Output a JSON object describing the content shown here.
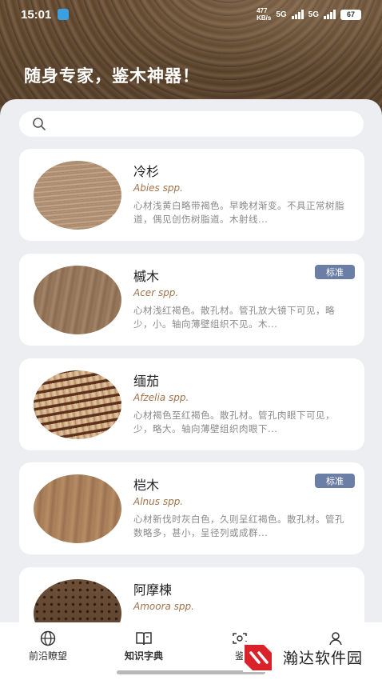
{
  "status": {
    "time": "15:01",
    "net_speed_top": "477",
    "net_speed_bottom": "KB/s",
    "signal1": "5G",
    "signal2": "5G",
    "battery": "67"
  },
  "header": {
    "slogan": "随身专家，鉴木神器！"
  },
  "search": {
    "placeholder": ""
  },
  "woods": [
    {
      "name": "冷杉",
      "latin": "Abies spp.",
      "desc": "心材浅黄白略带褐色。早晚材渐变。不具正常树脂道，偶见创伤树脂道。木射线...",
      "badge": ""
    },
    {
      "name": "槭木",
      "latin": "Acer spp.",
      "desc": "心材浅红褐色。散孔材。管孔放大镜下可见，略少，小。轴向薄壁组织不见。木...",
      "badge": "标准"
    },
    {
      "name": "缅茄",
      "latin": "Afzelia spp.",
      "desc": "心材褐色至红褐色。散孔材。管孔肉眼下可见，少，略大。轴向薄壁组织肉眼下...",
      "badge": ""
    },
    {
      "name": "桤木",
      "latin": "Alnus spp.",
      "desc": "心材新伐时灰白色，久则呈红褐色。散孔材。管孔数略多，甚小，呈径列或成群...",
      "badge": "标准"
    },
    {
      "name": "阿摩楝",
      "latin": "Amoora spp.",
      "desc": "",
      "badge": ""
    }
  ],
  "nav": {
    "items": [
      {
        "label": "前沿瞭望",
        "icon": "globe-icon"
      },
      {
        "label": "知识字典",
        "icon": "book-icon"
      },
      {
        "label": "鉴",
        "icon": "camera-scan-icon"
      },
      {
        "label": "",
        "icon": "user-icon"
      }
    ]
  },
  "watermark": {
    "text": "瀚达软件园"
  }
}
